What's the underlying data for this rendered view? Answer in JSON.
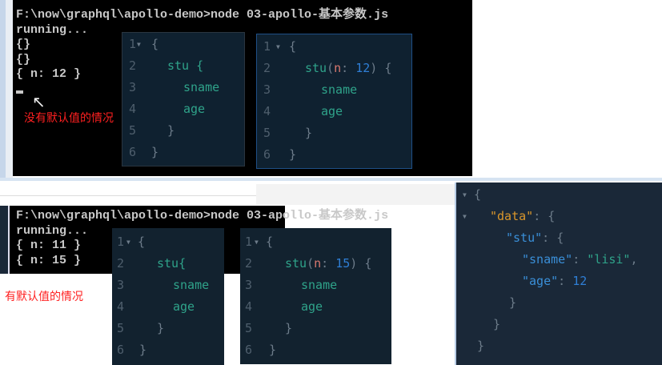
{
  "top": {
    "terminal_lines": [
      "F:\\now\\graphql\\apollo-demo>node 03-apollo-基本参数.js",
      "running...",
      "{}",
      "{}",
      "{ n: 12 }"
    ],
    "annotation": "没有默认值的情况",
    "editor_a": {
      "line_numbers": [
        "1",
        "2",
        "3",
        "4",
        "5",
        "6"
      ],
      "lines": [
        "{",
        "stu {",
        "sname",
        "age",
        "}",
        "}"
      ]
    },
    "editor_b": {
      "line_numbers": [
        "1",
        "2",
        "3",
        "4",
        "5",
        "6"
      ],
      "field": "stu",
      "arg_name": "n",
      "arg_value": "12",
      "lines": [
        "{",
        "sname",
        "age",
        "}",
        "}"
      ]
    }
  },
  "bottom": {
    "terminal_lines": [
      "F:\\now\\graphql\\apollo-demo>node 03-apollo-基本参数.js",
      "running...",
      "{ n: 11 }",
      "{ n: 15 }"
    ],
    "annotation": "有默认值的情况",
    "editor_c": {
      "line_numbers": [
        "1",
        "2",
        "3",
        "4",
        "5",
        "6"
      ],
      "lines": [
        "{",
        "stu{",
        "sname",
        "age",
        "}",
        "}"
      ]
    },
    "editor_d": {
      "line_numbers": [
        "1",
        "2",
        "3",
        "4",
        "5",
        "6"
      ],
      "field": "stu",
      "arg_name": "n",
      "arg_value": "15",
      "lines": [
        "{",
        "sname",
        "age",
        "}",
        "}"
      ]
    }
  },
  "result": {
    "data_key": "\"data\"",
    "stu_key": "\"stu\"",
    "sname_key": "\"sname\"",
    "sname_value": "\"lisi\"",
    "age_key": "\"age\"",
    "age_value": "12"
  }
}
